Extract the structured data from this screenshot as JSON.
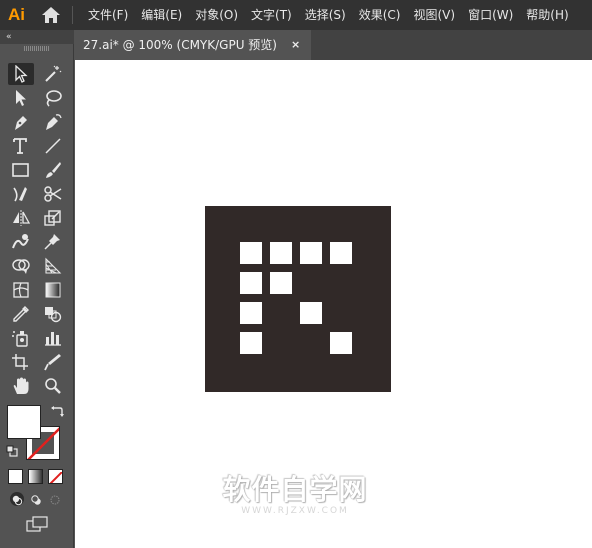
{
  "app": {
    "logo_text": "Ai",
    "logo_color": "#ff9a00"
  },
  "menu": {
    "items": [
      "文件(F)",
      "编辑(E)",
      "对象(O)",
      "文字(T)",
      "选择(S)",
      "效果(C)",
      "视图(V)",
      "窗口(W)",
      "帮助(H)"
    ]
  },
  "toolbar": {
    "collapse_glyph": "«",
    "tools": [
      {
        "name": "selection-tool",
        "icon": "arrow-outline-icon",
        "active": true
      },
      {
        "name": "magic-wand-tool",
        "icon": "magic-wand-icon"
      },
      {
        "name": "direct-selection-tool",
        "icon": "arrow-filled-icon"
      },
      {
        "name": "lasso-tool",
        "icon": "lasso-icon"
      },
      {
        "name": "pen-tool",
        "icon": "pen-icon"
      },
      {
        "name": "curvature-tool",
        "icon": "curvature-pen-icon"
      },
      {
        "name": "type-tool",
        "icon": "type-icon"
      },
      {
        "name": "line-tool",
        "icon": "line-icon"
      },
      {
        "name": "rectangle-tool",
        "icon": "rectangle-icon"
      },
      {
        "name": "paintbrush-tool",
        "icon": "brush-icon"
      },
      {
        "name": "shaper-tool",
        "icon": "shaper-icon"
      },
      {
        "name": "scissors-tool",
        "icon": "scissors-icon"
      },
      {
        "name": "reflect-tool",
        "icon": "reflect-icon"
      },
      {
        "name": "scale-tool",
        "icon": "scale-icon"
      },
      {
        "name": "warp-tool",
        "icon": "warp-icon"
      },
      {
        "name": "puppet-warp-tool",
        "icon": "pushpin-icon"
      },
      {
        "name": "shape-builder-tool",
        "icon": "shape-builder-icon"
      },
      {
        "name": "perspective-grid-tool",
        "icon": "perspective-grid-icon"
      },
      {
        "name": "mesh-tool",
        "icon": "mesh-icon"
      },
      {
        "name": "gradient-tool",
        "icon": "gradient-icon"
      },
      {
        "name": "eyedropper-tool",
        "icon": "eyedropper-icon"
      },
      {
        "name": "blend-tool",
        "icon": "blend-icon"
      },
      {
        "name": "symbol-sprayer-tool",
        "icon": "symbol-sprayer-icon"
      },
      {
        "name": "column-graph-tool",
        "icon": "bar-graph-icon"
      },
      {
        "name": "artboard-tool",
        "icon": "artboard-icon"
      },
      {
        "name": "slice-tool",
        "icon": "slice-knife-icon"
      },
      {
        "name": "hand-tool",
        "icon": "hand-icon"
      },
      {
        "name": "zoom-tool",
        "icon": "magnifier-icon"
      }
    ]
  },
  "document": {
    "tab_title": "27.ai* @ 100% (CMYK/GPU 预览)",
    "close_glyph": "×"
  },
  "artwork": {
    "background_color": "#312928",
    "square_color": "#ffffff"
  },
  "watermark": {
    "main": "软件自学网",
    "sub": "WWW.RJZXW.COM"
  }
}
